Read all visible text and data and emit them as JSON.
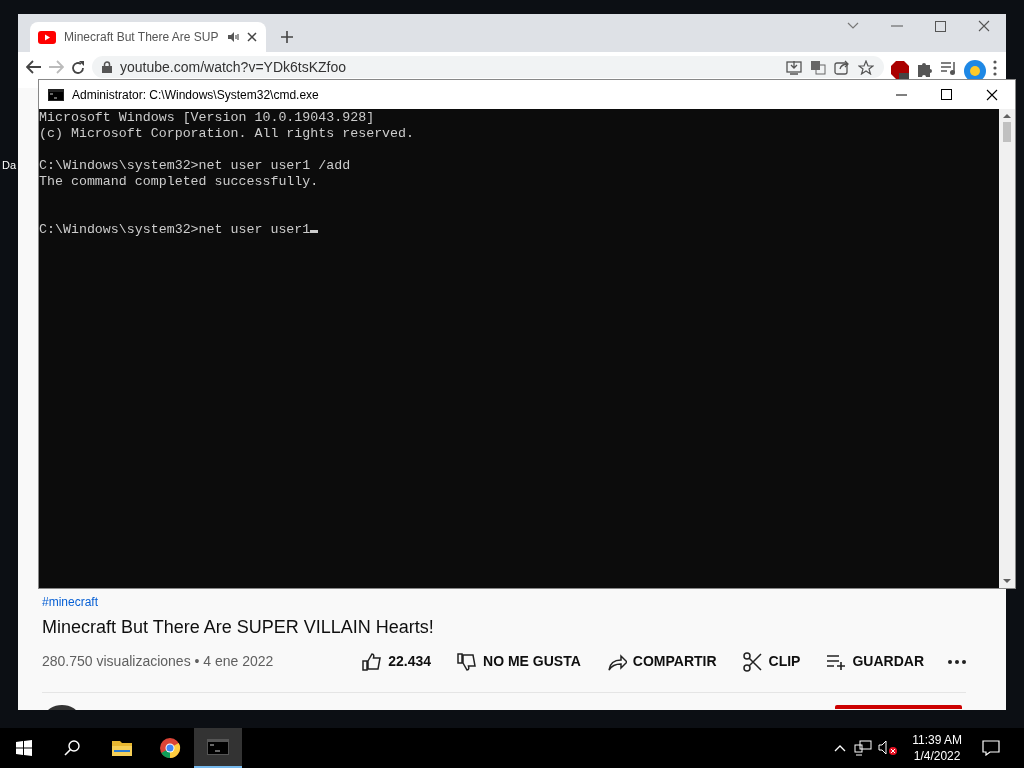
{
  "desktop": {
    "icon_label": "Da"
  },
  "browser": {
    "tabs": [
      {
        "title": "Minecraft But There Are SUP",
        "selected": true,
        "audio": true
      }
    ],
    "url": "youtube.com/watch?v=YDk6tsKZfoo"
  },
  "video": {
    "hashtag": "#minecraft",
    "title": "Minecraft But There Are SUPER VILLAIN Hearts!",
    "meta": "280.750 visualizaciones • 4 ene 2022",
    "actions": [
      {
        "kind": "like",
        "label": "22.434"
      },
      {
        "kind": "dislike",
        "label": "NO ME GUSTA"
      },
      {
        "kind": "share",
        "label": "COMPARTIR"
      },
      {
        "kind": "clip",
        "label": "CLIP"
      },
      {
        "kind": "save",
        "label": "GUARDAR"
      },
      {
        "kind": "more"
      }
    ]
  },
  "cmd": {
    "title": "Administrator: C:\\Windows\\System32\\cmd.exe",
    "blocks": [
      [
        "Microsoft Windows [Version 10.0.19043.928]",
        "(c) Microsoft Corporation. All rights reserved."
      ],
      [
        "C:\\Windows\\system32>net user user1 /add",
        "The command completed successfully."
      ]
    ],
    "prompt": {
      "text": "C:\\Windows\\system32>net user user1",
      "cursor": true
    }
  },
  "taskbar": {
    "apps": [
      {
        "kind": "folder",
        "selected": false
      },
      {
        "kind": "chrome",
        "selected": false
      },
      {
        "kind": "cmd",
        "selected": true
      }
    ],
    "time": "11:39 AM",
    "date": "1/4/2022"
  }
}
